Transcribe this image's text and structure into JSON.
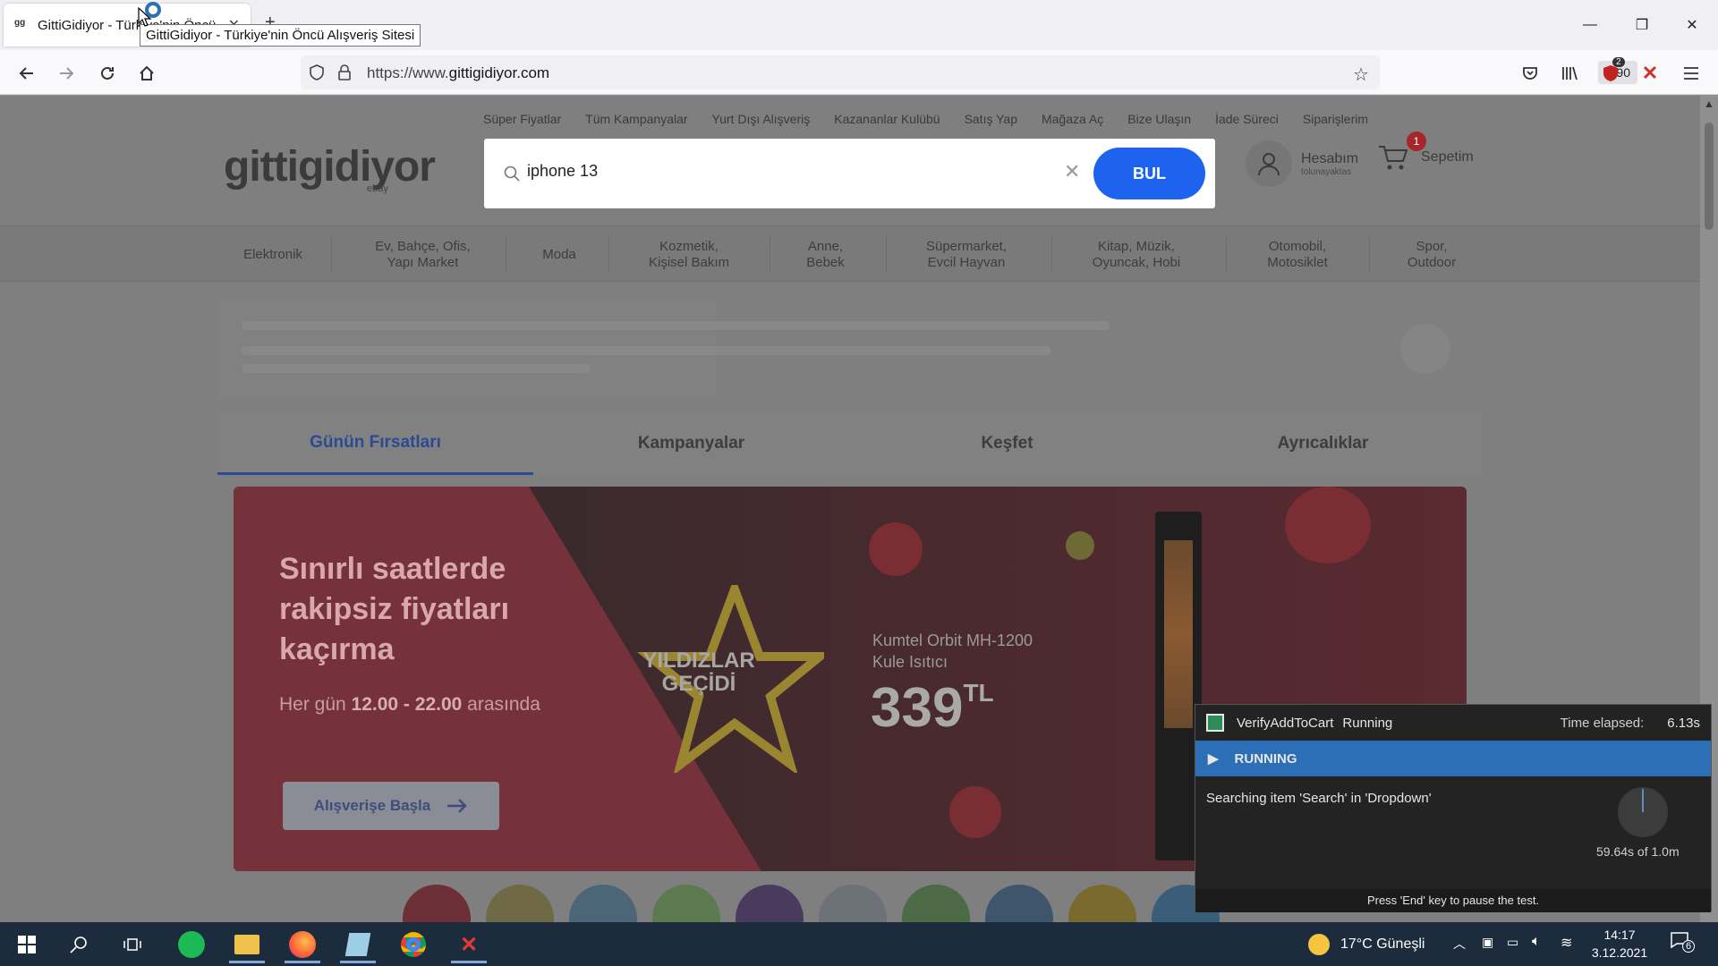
{
  "browser": {
    "tab_title": "GittiGidiyor - Türkiye'nin Öncü Alışveriş Sitesi",
    "tab_favicon": "gg",
    "tooltip": "GittiGidiyor - Türkiye'nin Öncü Alışveriş Sitesi",
    "url_prefix": "https://www.",
    "url_domain": "gittigidiyor.com",
    "zoom": "%90",
    "extension_badge": "2"
  },
  "site": {
    "top_links": [
      "Süper Fiyatlar",
      "Tüm Kampanyalar",
      "Yurt Dışı Alışveriş",
      "Kazananlar Kulübü",
      "Satış Yap",
      "Mağaza Aç",
      "Bize Ulaşın",
      "İade Süreci",
      "Siparişlerim"
    ],
    "logo": "gittigidiyor",
    "logo_sub": "ebay",
    "search_value": "iphone 13",
    "search_button": "BUL",
    "account_title": "Hesabım",
    "account_sub": "tolunayaktas",
    "cart_label": "Sepetim",
    "cart_count": "1",
    "categories": [
      "Elektronik",
      "Ev, Bahçe, Ofis,\nYapı Market",
      "Moda",
      "Kozmetik,\nKişisel Bakım",
      "Anne,\nBebek",
      "Süpermarket,\nEvcil Hayvan",
      "Kitap, Müzik,\nOyuncak, Hobi",
      "Otomobil,\nMotosiklet",
      "Spor,\nOutdoor"
    ],
    "tabs": [
      "Günün Fırsatları",
      "Kampanyalar",
      "Keşfet",
      "Ayrıcalıklar"
    ],
    "banner": {
      "headline_1": "Sınırlı saatlerde",
      "headline_2": "rakipsiz fiyatları",
      "headline_3": "kaçırma",
      "sub_pre": "Her gün ",
      "sub_bold": "12.00 - 22.00",
      "sub_post": " arasında",
      "button": "Alışverişe Başla",
      "star_line_1": "YILDIZLAR",
      "star_line_2": "GEÇİDİ",
      "product_line_1": "Kumtel Orbit MH-1200",
      "product_line_2": "Kule Isıtıcı",
      "price": "339",
      "currency": "TL"
    }
  },
  "runner": {
    "test_name": "VerifyAddToCart",
    "status": "Running",
    "elapsed_label": "Time elapsed:",
    "elapsed_value": "6.13s",
    "state": "RUNNING",
    "message": "Searching item 'Search' in 'Dropdown'",
    "progress_text": "59.64s of 1.0m",
    "footer": "Press 'End' key to pause the test."
  },
  "taskbar": {
    "weather": "17°C Güneşli",
    "time": "14:17",
    "date": "3.12.2021",
    "notifications": "6"
  }
}
